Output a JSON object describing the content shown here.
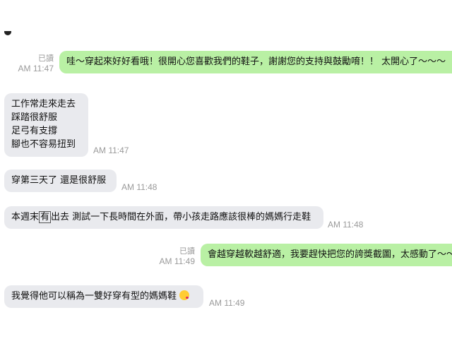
{
  "messages": [
    {
      "side": "outgoing",
      "read_label": "已讀",
      "time": "AM 11:47",
      "lines": [
        "哇～穿起來好好看哦！很開心您喜歡我們的鞋子，謝謝您的支持與鼓勵唷！！ 太開心了～～～"
      ]
    },
    {
      "side": "incoming",
      "time": "AM 11:47",
      "lines": [
        "工作常走來走去",
        "踩踏很舒服",
        "足弓有支撐",
        "腳也不容易扭到"
      ]
    },
    {
      "side": "incoming",
      "time": "AM 11:48",
      "lines": [
        "穿第三天了 還是很舒服"
      ]
    },
    {
      "side": "incoming",
      "time": "AM 11:48",
      "text_before_box": "本週末",
      "boxed_char": "有",
      "text_after_box": "出去 測試一下長時間在外面，帶小孩走路應該很棒的媽媽行走鞋"
    },
    {
      "side": "outgoing",
      "read_label": "已讀",
      "time": "AM 11:49",
      "lines": [
        "會越穿越軟越舒適，我要趕快把您的誇獎截圖，太感動了～～"
      ]
    },
    {
      "side": "incoming",
      "time": "AM 11:49",
      "lines": [
        "我覺得他可以稱為一雙好穿有型的媽媽鞋"
      ],
      "emoji": "kissing-face-emoji"
    }
  ]
}
